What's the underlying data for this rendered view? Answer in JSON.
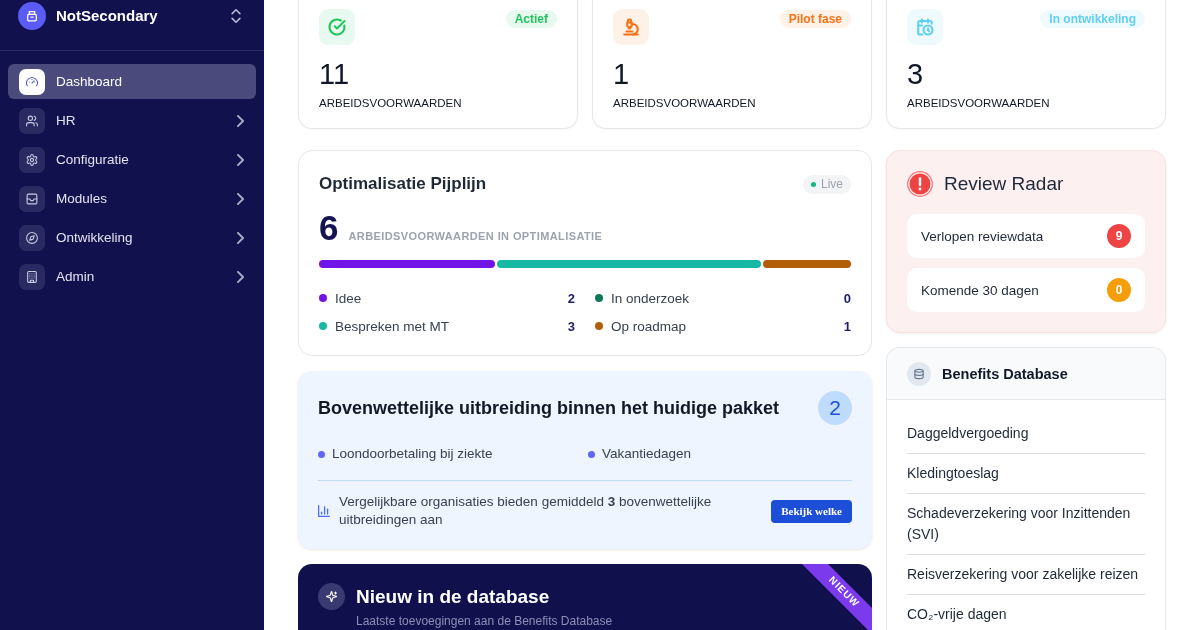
{
  "sidebar": {
    "workspace": "NotSecondary",
    "items": [
      {
        "label": "Dashboard",
        "selected": true,
        "submenu": false
      },
      {
        "label": "HR",
        "selected": false,
        "submenu": true
      },
      {
        "label": "Configuratie",
        "selected": false,
        "submenu": true
      },
      {
        "label": "Modules",
        "selected": false,
        "submenu": true
      },
      {
        "label": "Ontwikkeling",
        "selected": false,
        "submenu": true
      },
      {
        "label": "Admin",
        "selected": false,
        "submenu": true
      }
    ]
  },
  "status_cards": [
    {
      "status": "Actief",
      "color": "#22c55e",
      "count": "11",
      "label": "ARBEIDSVOORWAARDEN"
    },
    {
      "status": "Pilot fase",
      "color": "#f97316",
      "count": "1",
      "label": "ARBEIDSVOORWAARDEN"
    },
    {
      "status": "In ontwikkeling",
      "color": "#5fd0f3",
      "count": "3",
      "label": "ARBEIDSVOORWAARDEN"
    }
  ],
  "optimization": {
    "title": "Optimalisatie Pijplijn",
    "status": "Live",
    "total": "6",
    "total_label": "ARBEIDSVOORWAARDEN IN OPTIMALISATIE",
    "stages": [
      {
        "label": "Idee",
        "count": "2",
        "color": "#7014e8"
      },
      {
        "label": "In onderzoek",
        "count": "0",
        "color": "#0d7a57"
      },
      {
        "label": "Bespreken met MT",
        "count": "3",
        "color": "#17b8a6"
      },
      {
        "label": "Op roadmap",
        "count": "1",
        "color": "#b25e09"
      }
    ]
  },
  "extension": {
    "title": "Bovenwettelijke uitbreiding binnen het huidige pakket",
    "count": "2",
    "items": [
      "Loondoorbetaling bij ziekte",
      "Vakantiedagen"
    ],
    "note": "Vergelijkbare organisaties bieden gemiddeld **3** bovenwettelijke uitbreidingen aan",
    "button": "Bekijk welke"
  },
  "new_in_database": {
    "ribbon": "NIEUW",
    "title": "Nieuw in de database",
    "subtitle": "Laatste toevoegingen aan de Benefits Database"
  },
  "review_radar": {
    "title": "Review Radar",
    "rows": [
      {
        "label": "Verlopen reviewdata",
        "count": "9",
        "color": "#ef4444"
      },
      {
        "label": "Komende 30 dagen",
        "count": "0",
        "color": "#f59e0b"
      }
    ]
  },
  "benefits_database": {
    "title": "Benefits Database",
    "items": [
      "Daggeldvergoeding",
      "Kledingtoeslag",
      "Schadeverzekering voor Inzittenden (SVI)",
      "Reisverzekering voor zakelijke reizen",
      "CO₂-vrije dagen"
    ]
  }
}
